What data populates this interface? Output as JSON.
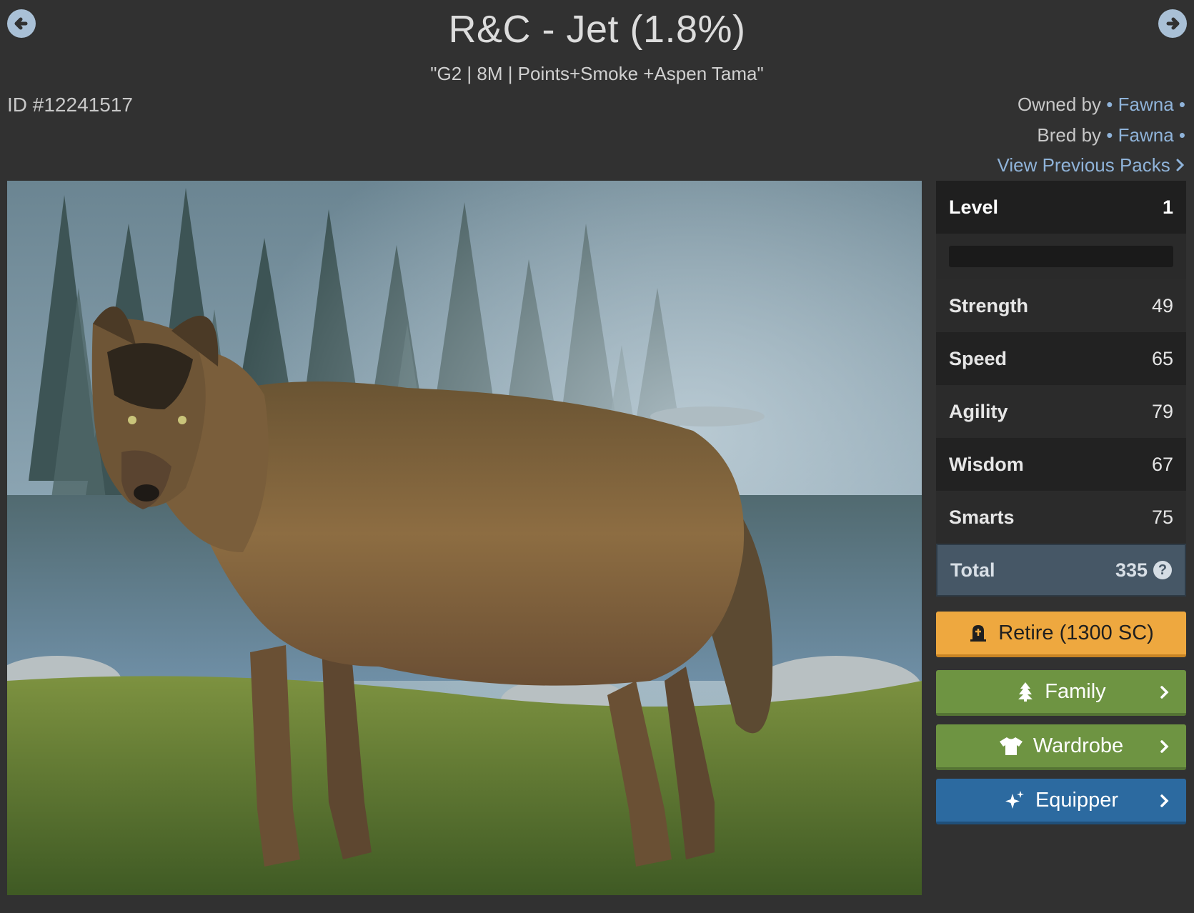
{
  "header": {
    "title": "R&C - Jet (1.8%)",
    "subtitle": "\"G2 | 8M | Points+Smoke +Aspen Tama\"",
    "prev_icon": "arrow-left-circle-icon",
    "next_icon": "arrow-right-circle-icon"
  },
  "meta": {
    "id": "ID #12241517",
    "owned_label": "Owned by",
    "owner": "Fawna",
    "bred_label": "Bred by",
    "breeder": "Fawna",
    "previous_packs": "View Previous Packs"
  },
  "stats": {
    "level_label": "Level",
    "level_value": "1",
    "xp_progress": 0,
    "rows": [
      {
        "label": "Strength",
        "value": "49"
      },
      {
        "label": "Speed",
        "value": "65"
      },
      {
        "label": "Agility",
        "value": "79"
      },
      {
        "label": "Wisdom",
        "value": "67"
      },
      {
        "label": "Smarts",
        "value": "75"
      }
    ],
    "total_label": "Total",
    "total_value": "335",
    "help_icon": "question-circle-icon"
  },
  "actions": {
    "retire": "Retire (1300 SC)",
    "family": "Family",
    "wardrobe": "Wardrobe",
    "equipper": "Equipper"
  },
  "colors": {
    "background": "#313131",
    "link": "#8fb3d9",
    "retire": "#eea83f",
    "family": "#6e9442",
    "wardrobe": "#6e9442",
    "equipper": "#2c6aa0",
    "total_row": "#465766"
  }
}
